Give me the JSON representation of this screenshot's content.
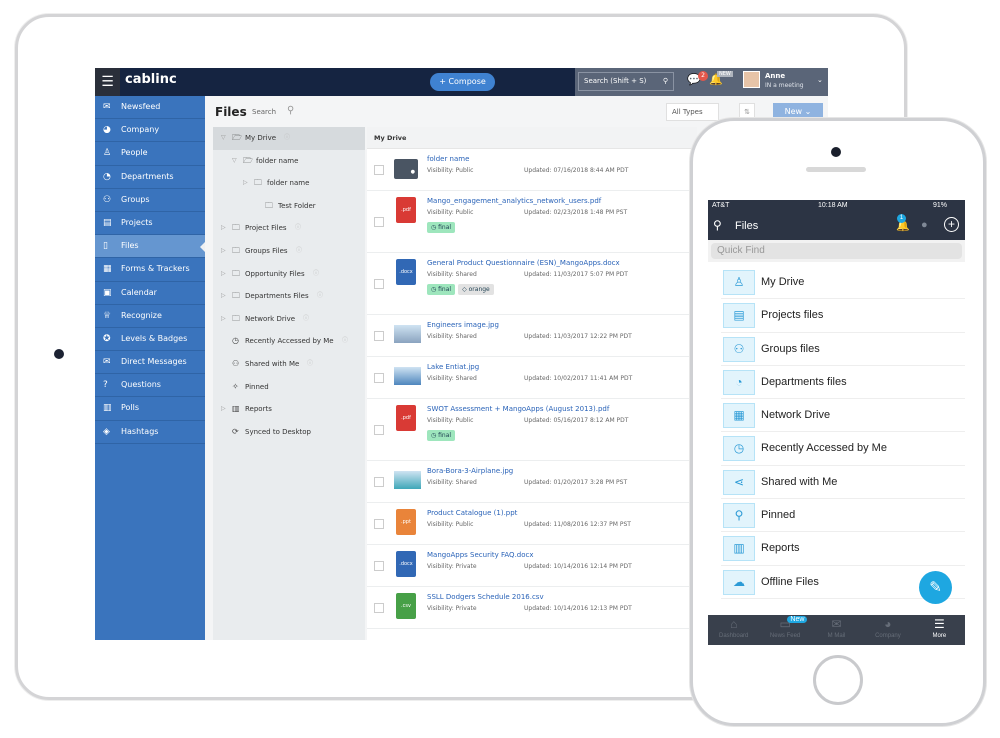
{
  "app": {
    "logo": "cablinc",
    "compose": "+ Compose",
    "search_placeholder": "Search (Shift + S)",
    "chat_count": "2",
    "bell_badge": "NEW",
    "user_name": "Anne",
    "user_status": "IN a meeting"
  },
  "sidebar": {
    "items": [
      {
        "label": "Newsfeed",
        "icon": "inbox-icon",
        "glyph": "✉"
      },
      {
        "label": "Company",
        "icon": "globe-icon",
        "glyph": "◕"
      },
      {
        "label": "People",
        "icon": "person-icon",
        "glyph": "♙"
      },
      {
        "label": "Departments",
        "icon": "pie-icon",
        "glyph": "◔"
      },
      {
        "label": "Groups",
        "icon": "group-icon",
        "glyph": "⚇"
      },
      {
        "label": "Projects",
        "icon": "briefcase-icon",
        "glyph": "▤"
      },
      {
        "label": "Files",
        "icon": "file-icon",
        "glyph": "▯",
        "active": true
      },
      {
        "label": "Forms & Trackers",
        "icon": "grid-icon",
        "glyph": "▦"
      },
      {
        "label": "Calendar",
        "icon": "calendar-icon",
        "glyph": "▣"
      },
      {
        "label": "Recognize",
        "icon": "trophy-icon",
        "glyph": "♕"
      },
      {
        "label": "Levels & Badges",
        "icon": "badge-icon",
        "glyph": "✪"
      },
      {
        "label": "Direct Messages",
        "icon": "message-icon",
        "glyph": "✉"
      },
      {
        "label": "Questions",
        "icon": "question-icon",
        "glyph": "?"
      },
      {
        "label": "Polls",
        "icon": "bar-chart-icon",
        "glyph": "▥"
      },
      {
        "label": "Hashtags",
        "icon": "tag-icon",
        "glyph": "◈"
      }
    ]
  },
  "files": {
    "title": "Files",
    "search_label": "Search",
    "filter": "All Types",
    "new_button": "New ⌄",
    "list_header": "My Drive",
    "tree": [
      {
        "label": "My Drive",
        "indent": 0,
        "twisty": "▽",
        "glyph": "🗁",
        "info": true,
        "selected": true
      },
      {
        "label": "folder name",
        "indent": 1,
        "twisty": "▽",
        "glyph": "🗁"
      },
      {
        "label": "folder name",
        "indent": 2,
        "twisty": "▷",
        "glyph": "🗀"
      },
      {
        "label": "Test Folder",
        "indent": 3,
        "twisty": "",
        "glyph": "🗀"
      },
      {
        "label": "Project Files",
        "indent": 0,
        "twisty": "▷",
        "glyph": "🗀",
        "info": true
      },
      {
        "label": "Groups Files",
        "indent": 0,
        "twisty": "▷",
        "glyph": "🗀",
        "info": true
      },
      {
        "label": "Opportunity Files",
        "indent": 0,
        "twisty": "▷",
        "glyph": "🗀",
        "info": true
      },
      {
        "label": "Departments Files",
        "indent": 0,
        "twisty": "▷",
        "glyph": "🗀",
        "info": true
      },
      {
        "label": "Network Drive",
        "indent": 0,
        "twisty": "▷",
        "glyph": "🗀",
        "info": true
      },
      {
        "label": "Recently Accessed by Me",
        "indent": 0,
        "twisty": "",
        "glyph": "◷",
        "info": true
      },
      {
        "label": "Shared with Me",
        "indent": 0,
        "twisty": "",
        "glyph": "⚇",
        "info": true
      },
      {
        "label": "Pinned",
        "indent": 0,
        "twisty": "",
        "glyph": "✧"
      },
      {
        "label": "Reports",
        "indent": 0,
        "twisty": "▷",
        "glyph": "▥"
      },
      {
        "label": "Synced to Desktop",
        "indent": 0,
        "twisty": "",
        "glyph": "⟳"
      }
    ],
    "rows": [
      {
        "name": "folder name",
        "type": "folder",
        "ext": "",
        "color": "#4a5563",
        "visibility": "Visibility: Public",
        "updated": "Updated: 07/16/2018 8:44 AM PDT",
        "tags": []
      },
      {
        "name": "Mango_engagement_analytics_network_users.pdf",
        "type": "doc",
        "ext": ".pdf",
        "color": "#d93a35",
        "visibility": "Visibility: Public",
        "updated": "Updated: 02/23/2018 1:48 PM PST",
        "tags": [
          {
            "label": "final",
            "kind": "green"
          }
        ]
      },
      {
        "name": "General Product Questionnaire (ESN)_MangoApps.docx",
        "type": "doc",
        "ext": ".docx",
        "color": "#3168b5",
        "visibility": "Visibility: Shared",
        "updated": "Updated: 11/03/2017 5:07 PM PDT",
        "tags": [
          {
            "label": "final",
            "kind": "green"
          },
          {
            "label": "orange",
            "kind": "grey"
          }
        ]
      },
      {
        "name": "Engineers image.jpg",
        "type": "image",
        "ext": "",
        "color": "#8aa3bf",
        "visibility": "Visibility: Shared",
        "updated": "Updated: 11/03/2017 12:22 PM PDT",
        "tags": []
      },
      {
        "name": "Lake Entiat.jpg",
        "type": "image",
        "ext": "",
        "color": "#4e86bd",
        "visibility": "Visibility: Shared",
        "updated": "Updated: 10/02/2017 11:41 AM PDT",
        "tags": []
      },
      {
        "name": "SWOT Assessment + MangoApps (August 2013).pdf",
        "type": "doc",
        "ext": ".pdf",
        "color": "#d93a35",
        "visibility": "Visibility: Public",
        "updated": "Updated: 05/16/2017 8:12 AM PDT",
        "tags": [
          {
            "label": "final",
            "kind": "green"
          }
        ]
      },
      {
        "name": "Bora-Bora-3-Airplane.jpg",
        "type": "image",
        "ext": "",
        "color": "#3fa7b8",
        "visibility": "Visibility: Shared",
        "updated": "Updated: 01/20/2017 3:28 PM PST",
        "tags": []
      },
      {
        "name": "Product Catalogue (1).ppt",
        "type": "doc",
        "ext": ".ppt",
        "color": "#e9843a",
        "visibility": "Visibility: Public",
        "updated": "Updated: 11/08/2016 12:37 PM PST",
        "tags": []
      },
      {
        "name": "MangoApps Security FAQ.docx",
        "type": "doc",
        "ext": ".docx",
        "color": "#3168b5",
        "visibility": "Visibility: Private",
        "updated": "Updated: 10/14/2016 12:14 PM PDT",
        "tags": []
      },
      {
        "name": "SSLL Dodgers Schedule 2016.csv",
        "type": "doc",
        "ext": ".csv",
        "color": "#47a047",
        "visibility": "Visibility: Private",
        "updated": "Updated: 10/14/2016 12:13 PM PDT",
        "tags": []
      }
    ]
  },
  "phone": {
    "carrier": "AT&T",
    "time": "10:18 AM",
    "battery": "91%",
    "title": "Files",
    "notif_count": "1",
    "quick_find": "Quick Find",
    "items": [
      {
        "label": "My Drive",
        "glyph": "♙",
        "icon": "person-icon"
      },
      {
        "label": "Projects files",
        "glyph": "▤",
        "icon": "briefcase-icon"
      },
      {
        "label": "Groups files",
        "glyph": "⚇",
        "icon": "group-icon"
      },
      {
        "label": "Departments files",
        "glyph": "◔",
        "icon": "pie-icon"
      },
      {
        "label": "Network Drive",
        "glyph": "▦",
        "icon": "building-icon"
      },
      {
        "label": "Recently Accessed by Me",
        "glyph": "◷",
        "icon": "clock-icon"
      },
      {
        "label": "Shared with Me",
        "glyph": "⋖",
        "icon": "share-icon"
      },
      {
        "label": "Pinned",
        "glyph": "⚲",
        "icon": "pin-icon"
      },
      {
        "label": "Reports",
        "glyph": "▥",
        "icon": "chart-icon"
      },
      {
        "label": "Offline Files",
        "glyph": "☁",
        "icon": "cloud-download-icon"
      }
    ],
    "tabs": [
      {
        "label": "Dashboard",
        "glyph": "⌂",
        "icon": "home-icon"
      },
      {
        "label": "News Feed",
        "glyph": "▭",
        "icon": "inbox-icon",
        "badge": "New"
      },
      {
        "label": "M Mail",
        "glyph": "✉",
        "icon": "mail-icon"
      },
      {
        "label": "Company",
        "glyph": "◕",
        "icon": "globe-icon"
      },
      {
        "label": "More",
        "glyph": "☰",
        "icon": "menu-icon",
        "active": true
      }
    ]
  }
}
